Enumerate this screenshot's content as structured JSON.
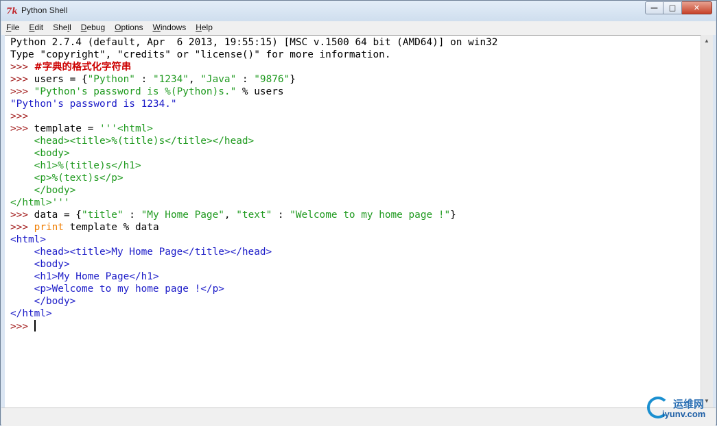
{
  "window": {
    "title": "Python Shell",
    "app_icon": "7k"
  },
  "menu": {
    "items": [
      {
        "u": "F",
        "rest": "ile"
      },
      {
        "u": "E",
        "rest": "dit"
      },
      {
        "pre": "She",
        "u": "l",
        "rest": "l"
      },
      {
        "u": "D",
        "rest": "ebug"
      },
      {
        "u": "O",
        "rest": "ptions"
      },
      {
        "u": "W",
        "rest": "indows"
      },
      {
        "u": "H",
        "rest": "elp"
      }
    ]
  },
  "shell": {
    "banner1": "Python 2.7.4 (default, Apr  6 2013, 19:55:15) [MSC v.1500 64 bit (AMD64)] on win32",
    "banner2": "Type \"copyright\", \"credits\" or \"license()\" for more information.",
    "prompt": ">>> ",
    "comment": "#字典的格式化字符串",
    "users_code": "users = {",
    "users_str1": "\"Python\"",
    "colon": " : ",
    "users_str2": "\"1234\"",
    "comma": ", ",
    "users_str3": "\"Java\"",
    "users_str4": "\"9876\"",
    "close_brace": "}",
    "fmt_str": "\"Python's password is %(Python)s.\"",
    "fmt_rest": " % users",
    "fmt_output": "\"Python's password is 1234.\"",
    "empty_prompt": ">>>",
    "tpl_code": "template = ",
    "tpl_line1": "'''<html>",
    "tpl_line2": "    <head><title>%(title)s</title></head>",
    "tpl_line3": "    <body>",
    "tpl_line4": "    <h1>%(title)s</h1>",
    "tpl_line5": "    <p>%(text)s</p>",
    "tpl_line6": "    </body>",
    "tpl_line7": "</html>'''",
    "data_code": "data = {",
    "data_str1": "\"title\"",
    "data_str2": "\"My Home Page\"",
    "data_str3": "\"text\"",
    "data_str4": "\"Welcome to my home page !\"",
    "print_kw": "print",
    "print_rest": " template % data",
    "out1": "<html>",
    "out2": "    <head><title>My Home Page</title></head>",
    "out3": "    <body>",
    "out4": "    <h1>My Home Page</h1>",
    "out5": "    <p>Welcome to my home page !</p>",
    "out6": "    </body>",
    "out7": "</html>"
  },
  "watermark": {
    "top": "运维网",
    "bottom": "iyunv.com"
  }
}
